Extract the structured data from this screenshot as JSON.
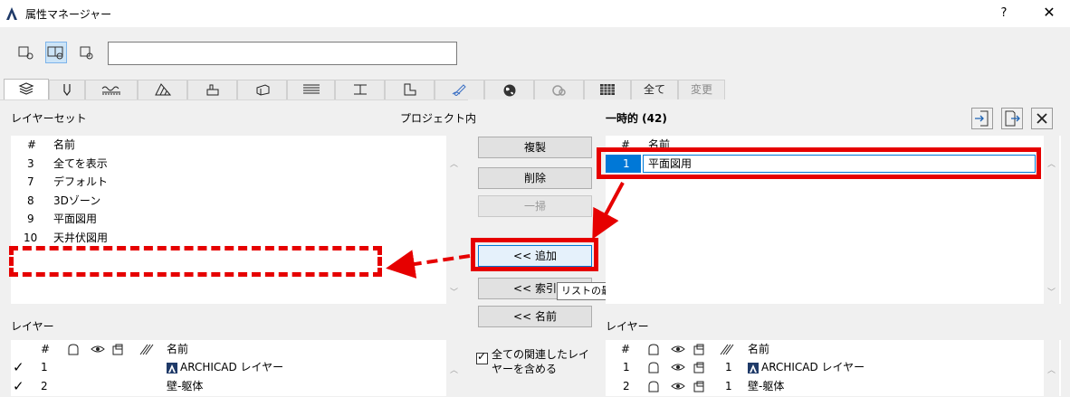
{
  "window": {
    "title": "属性マネージャー",
    "help": "?",
    "close": "✕"
  },
  "tabs": [
    {
      "name": "tab-layers",
      "icon": "layers-icon"
    },
    {
      "name": "tab-pens",
      "icon": "pen-icon"
    },
    {
      "name": "tab-line-types",
      "icon": "line-type-icon"
    },
    {
      "name": "tab-fills",
      "icon": "fill-icon"
    },
    {
      "name": "tab-composites",
      "icon": "composite-icon"
    },
    {
      "name": "tab-profiles",
      "icon": "profile-icon"
    },
    {
      "name": "tab-surfaces",
      "icon": "surface-icon"
    },
    {
      "name": "tab-building-materials",
      "icon": "building-material-icon"
    },
    {
      "name": "tab-zones",
      "icon": "zone-icon"
    },
    {
      "name": "tab-markup",
      "icon": "markup-icon"
    },
    {
      "name": "tab-locations",
      "icon": "globe-icon"
    },
    {
      "name": "tab-operation",
      "icon": "operation-icon"
    },
    {
      "name": "tab-schedules",
      "icon": "grid-icon"
    }
  ],
  "text_tabs": {
    "all": "全て",
    "changes": "変更"
  },
  "left": {
    "layer_set_label": "レイヤーセット",
    "project_label": "プロジェクト内",
    "col_num": "#",
    "col_name": "名前",
    "rows": [
      {
        "num": "3",
        "name": "全てを表示"
      },
      {
        "num": "7",
        "name": "デフォルト"
      },
      {
        "num": "8",
        "name": "3Dゾーン"
      },
      {
        "num": "9",
        "name": "平面図用"
      },
      {
        "num": "10",
        "name": "天井伏図用"
      }
    ],
    "layer_label": "レイヤー",
    "layer_rows": [
      {
        "check": "✓",
        "num": "1",
        "name": "ARCHICAD レイヤー"
      },
      {
        "check": "✓",
        "num": "2",
        "name": "壁-躯体"
      }
    ]
  },
  "middle": {
    "duplicate": "複製",
    "delete": "削除",
    "purge": "一掃",
    "add": "<< 追加",
    "index": "<< 索引",
    "name": "<< 名前",
    "tooltip": "リストの最後に追加",
    "include_label": "全ての関連したレイヤーを含める",
    "include_check": "✓"
  },
  "right": {
    "temp_label": "一時的 (42)",
    "col_num": "#",
    "col_name": "名前",
    "rows": [
      {
        "num": "1",
        "name": "平面図用"
      }
    ],
    "layer_label": "レイヤー",
    "layer_rows": [
      {
        "num": "1",
        "pen": "1",
        "name": "ARCHICAD レイヤー"
      },
      {
        "num": "2",
        "pen": "1",
        "name": "壁-躯体"
      }
    ]
  }
}
